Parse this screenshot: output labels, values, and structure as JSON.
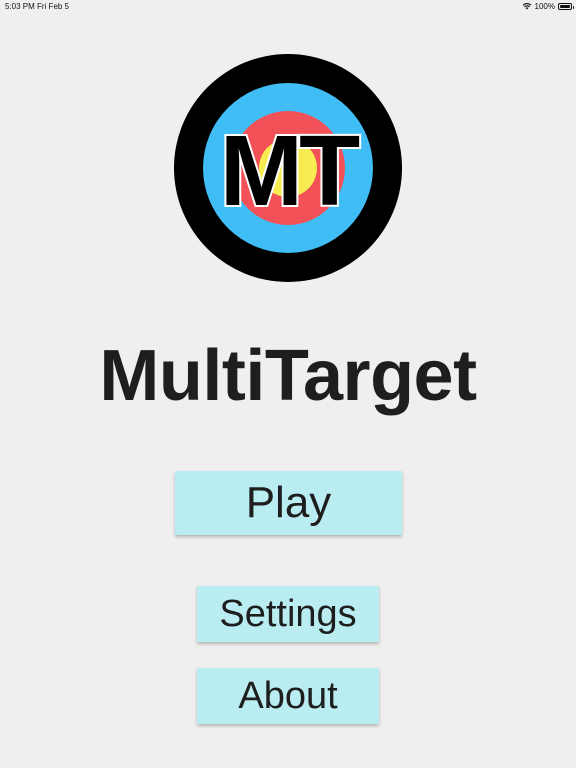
{
  "status_bar": {
    "time": "5:03 PM",
    "date": "Fri Feb 5",
    "battery": "100%",
    "battery_level": 1.0,
    "wifi_icon": "wifi-icon",
    "battery_icon": "battery-icon"
  },
  "logo": {
    "text": "MT",
    "icon": "archery-target-icon",
    "colors": {
      "outer_ring": "#000000",
      "blue_ring": "#41bdf6",
      "red_ring": "#f25257",
      "gold_center": "#f6ec52",
      "letters": "#000000"
    }
  },
  "app": {
    "title": "MultiTarget"
  },
  "menu": {
    "play_label": "Play",
    "settings_label": "Settings",
    "about_label": "About",
    "button_color": "#b9edf2"
  }
}
